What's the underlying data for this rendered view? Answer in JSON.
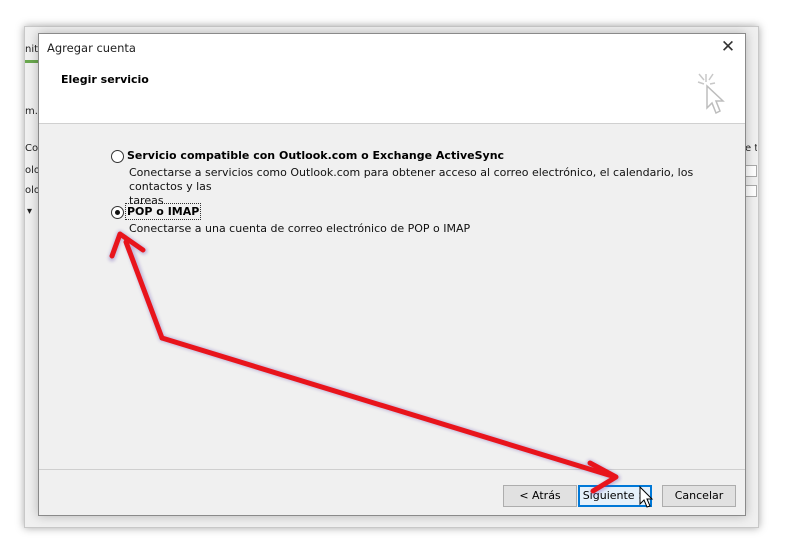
{
  "background": {
    "fragments": [
      "nita",
      "m.c",
      "Co",
      "olo",
      "olo",
      "▾",
      "e t"
    ]
  },
  "dialog": {
    "title": "Agregar cuenta",
    "close_glyph": "✕",
    "header_title": "Elegir servicio",
    "options": [
      {
        "label": "Servicio compatible con Outlook.com o Exchange ActiveSync",
        "description_line1": "Conectarse a servicios como Outlook.com para obtener acceso al correo electrónico, el calendario, los contactos y las",
        "description_line2": "tareas",
        "checked": false
      },
      {
        "label": "POP o IMAP",
        "description_line1": "Conectarse a una cuenta de correo electrónico de POP o IMAP",
        "checked": true
      }
    ],
    "buttons": {
      "back": "< Atrás",
      "next": "Siguiente >",
      "cancel": "Cancelar"
    }
  },
  "colors": {
    "arrow": "#e8141c",
    "focus": "#0078d7"
  },
  "icons": [
    "close-icon",
    "wizard-cursor-icon",
    "mouse-pointer-icon"
  ]
}
